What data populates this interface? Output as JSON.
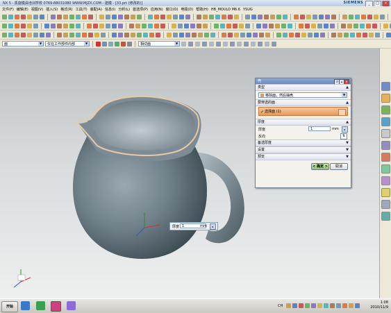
{
  "window": {
    "title": "NX 5 - 凯旋模具培训学校 0769-88031080 WWW.MJZX.COM - 建模 - [33.prt (修改的)]",
    "brand": "SIEMENS",
    "buttons": [
      "_",
      "□",
      "×"
    ]
  },
  "menu": [
    "文件(F)",
    "编辑(E)",
    "视图(V)",
    "插入(S)",
    "格式(R)",
    "工具(T)",
    "装配(A)",
    "信息(I)",
    "分析(L)",
    "首选项(P)",
    "应用(N)",
    "窗口(O)",
    "电极(D)",
    "帮助(H)",
    "HB_MOULD M6.6",
    "YSUG"
  ],
  "selection_bar": {
    "filter_value": "面",
    "scope_value": "仅在工作部件内部",
    "display_value": "相切面"
  },
  "dialog": {
    "title": "壳",
    "sections": {
      "type": {
        "label": "类型",
        "value": "移除面，然后抽壳"
      },
      "faces": {
        "label": "要穿透的面",
        "select_label": "选择面 (1)"
      },
      "thickness": {
        "label": "厚度",
        "field_label": "厚度",
        "value": "1",
        "unit": "mm",
        "reverse_label": "反向"
      },
      "alt_thickness": {
        "label": "备选厚度"
      },
      "settings": {
        "label": "设置"
      },
      "preview": {
        "label": "预览"
      }
    },
    "ok_label": "< 确定 >",
    "cancel_label": "取消"
  },
  "floating_input": {
    "label": "厚度",
    "value": "1",
    "unit": "mm"
  },
  "taskbar": {
    "start_label": "开始",
    "lang": "CH",
    "time": "1:08",
    "date": "2010/11/9"
  },
  "colors": {
    "accent": "#e79a5a",
    "title_blue": "#6b88b8",
    "model": "#6f7f88"
  }
}
